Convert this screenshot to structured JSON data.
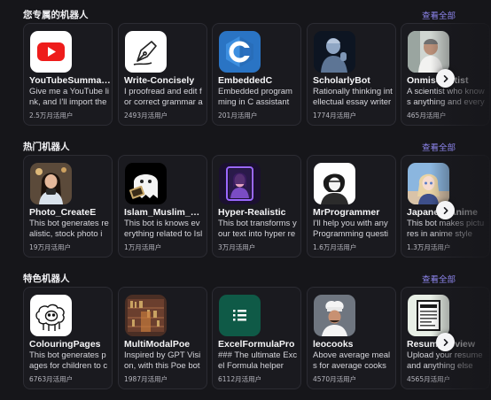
{
  "see_all_label": "查看全部",
  "sections": [
    {
      "title": "您专属的机器人",
      "bots": [
        {
          "name": "YouTubeSummarizer",
          "desc": "Give me a YouTube link, and I'll import the transcript",
          "users": "2.5万月活用户",
          "icon": "youtube-icon"
        },
        {
          "name": "Write-Concisely",
          "desc": "I proofread and edit for correct grammar and style",
          "users": "2493月活用户",
          "icon": "pen-nib-icon"
        },
        {
          "name": "EmbeddedC",
          "desc": "Embedded programming in C assistant",
          "users": "201月活用户",
          "icon": "c-language-icon"
        },
        {
          "name": "ScholarlyBot",
          "desc": "Rationally thinking intellectual essay writer",
          "users": "1774月活用户",
          "icon": "scholar-statue-icon"
        },
        {
          "name": "Onmiscientist",
          "desc": "A scientist who knows anything and everything",
          "users": "465月活用户",
          "icon": "scientist-portrait-icon"
        }
      ]
    },
    {
      "title": "热门机器人",
      "bots": [
        {
          "name": "Photo_CreateE",
          "desc": "This bot generates realistic, stock photo images",
          "users": "19万月活用户",
          "icon": "photo-girl-icon"
        },
        {
          "name": "Islam_Muslim_Bot",
          "desc": "This bot is knows everything related to Islam",
          "users": "1万月活用户",
          "icon": "ghost-book-icon"
        },
        {
          "name": "Hyper-Realistic",
          "desc": "This bot transforms your text into hyper realistic images",
          "users": "3万月活用户",
          "icon": "neon-portrait-icon"
        },
        {
          "name": "MrProgrammer",
          "desc": "I'll help you with any Programming questions",
          "users": "1.6万月活用户",
          "icon": "programmer-sketch-icon"
        },
        {
          "name": "JapaneseAnime",
          "desc": "This bot makes pictures in anime style",
          "users": "1.3万月活用户",
          "icon": "anime-girl-icon"
        }
      ]
    },
    {
      "title": "特色机器人",
      "bots": [
        {
          "name": "ColouringPages",
          "desc": "This bot generates pages for children to colour",
          "users": "6763月活用户",
          "icon": "sheep-outline-icon"
        },
        {
          "name": "MultiModalPoe",
          "desc": "Inspired by GPT Vision, with this Poe bot",
          "users": "1987月活用户",
          "icon": "library-icon"
        },
        {
          "name": "ExcelFormulaPro",
          "desc": "### The ultimate Excel Formula helper",
          "users": "6112月活用户",
          "icon": "list-icon"
        },
        {
          "name": "leocooks",
          "desc": "Above average meals for average cooks",
          "users": "4570月活用户",
          "icon": "chef-icon"
        },
        {
          "name": "ResumeReview",
          "desc": "Upload your resume and anything else",
          "users": "4565月活用户",
          "icon": "document-icon"
        }
      ]
    }
  ]
}
